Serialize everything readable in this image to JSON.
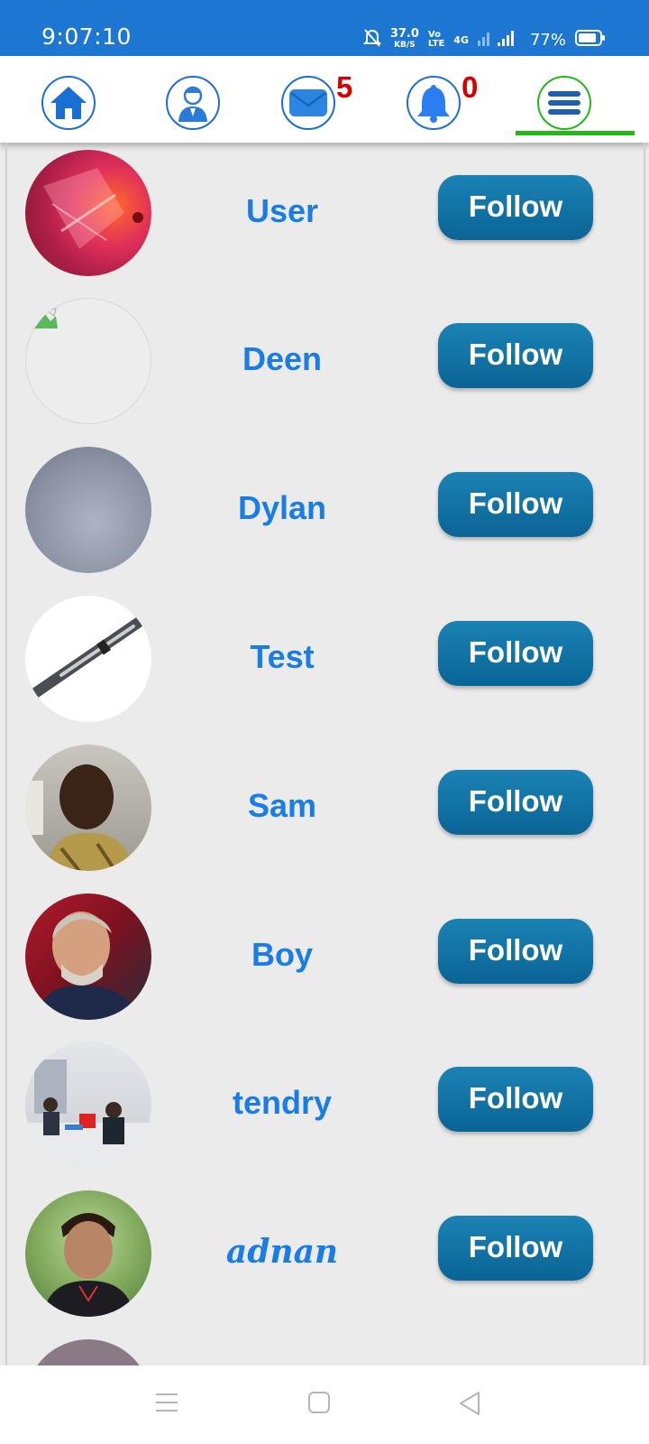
{
  "status_bar": {
    "time": "9:07:10",
    "speed_value": "37.0",
    "speed_unit": "KB/S",
    "volte_top": "Vo",
    "volte_bottom": "LTE",
    "network": "4G",
    "battery": "77%",
    "icons": [
      "mute-bell-icon",
      "signal-icon",
      "battery-icon"
    ]
  },
  "nav": {
    "items": [
      {
        "name": "home",
        "icon": "home-icon"
      },
      {
        "name": "profile",
        "icon": "person-icon"
      },
      {
        "name": "messages",
        "icon": "envelope-icon",
        "badge": "5"
      },
      {
        "name": "notifications",
        "icon": "bell-icon",
        "badge": "0"
      },
      {
        "name": "menu",
        "icon": "hamburger-icon",
        "active": true
      }
    ],
    "accent": "#1e6fd0",
    "active_color": "#26b51b",
    "badge_color": "#d40000"
  },
  "users": [
    {
      "name": "User",
      "follow_label": "Follow"
    },
    {
      "name": "Deen",
      "follow_label": "Follow"
    },
    {
      "name": "Dylan",
      "follow_label": "Follow"
    },
    {
      "name": "Test",
      "follow_label": "Follow"
    },
    {
      "name": "Sam",
      "follow_label": "Follow"
    },
    {
      "name": "Boy",
      "follow_label": "Follow"
    },
    {
      "name": "tendry",
      "follow_label": "Follow"
    },
    {
      "name": "adnan",
      "follow_label": "Follow"
    }
  ],
  "colors": {
    "name_text": "#1a7ce6",
    "follow_button": "#0a6495",
    "status_bar": "#1d77d2"
  },
  "system_nav": [
    "menu-lines-icon",
    "home-square-icon",
    "back-triangle-icon"
  ]
}
